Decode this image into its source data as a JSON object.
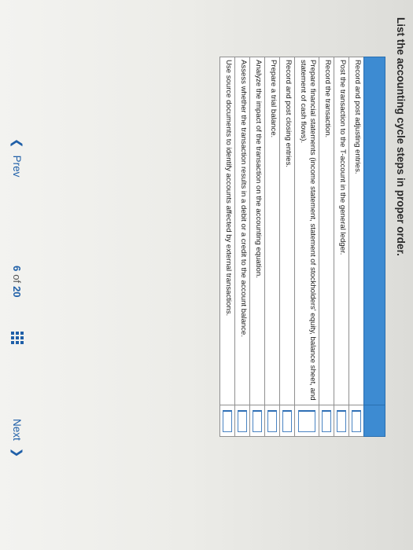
{
  "question": {
    "title": "List the accounting cycle steps in proper order."
  },
  "steps": [
    "Record and post adjusting entries.",
    "Post the transaction to the T-account in the general ledger.",
    "Record the transaction.",
    "Prepare financial statements (income statement, statement of stockholders' equity, balance sheet, and statement of cash flows).",
    "Record and post closing entries.",
    "Prepare a trial balance.",
    "Analyze the impact of the transaction on the accounting equation.",
    "Assess whether the transaction results in a debit or a credit to the account balance.",
    "Use source documents to identify accounts affected by external transactions."
  ],
  "navigation": {
    "prev_label": "Prev",
    "prev_icon": "chevron-left-icon",
    "current_page": "6",
    "of_label": "of",
    "total_pages": "20",
    "grid_icon": "grid-icon",
    "next_label": "Next",
    "next_icon": "chevron-right-icon"
  },
  "colors": {
    "accent": "#1f5fa8",
    "table_header": "#3d8bd2"
  }
}
